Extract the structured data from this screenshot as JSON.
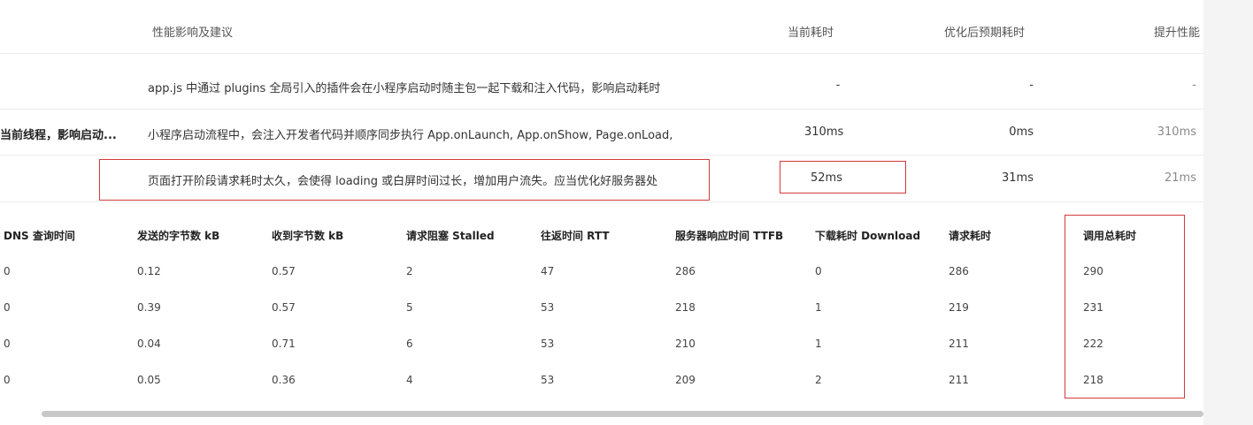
{
  "top_table": {
    "headers": {
      "impact": "性能影响及建议",
      "current": "当前耗时",
      "optimized": "优化后预期耗时",
      "improve": "提升性能"
    },
    "rows": [
      {
        "left": "",
        "desc": "app.js 中通过 plugins 全局引入的插件会在小程序启动时随主包一起下载和注入代码，影响启动耗时",
        "current": "-",
        "optimized": "-",
        "improve": "-"
      },
      {
        "left": "当前线程，影响启动...",
        "desc": "小程序启动流程中，会注入开发者代码并顺序同步执行 App.onLaunch, App.onShow, Page.onLoad,",
        "current": "310ms",
        "optimized": "0ms",
        "improve": "310ms"
      },
      {
        "left": "",
        "desc": "页面打开阶段请求耗时太久，会使得 loading 或白屏时间过长，增加用户流失。应当优化好服务器处",
        "current": "52ms",
        "optimized": "31ms",
        "improve": "21ms"
      }
    ]
  },
  "sub_table": {
    "headers": [
      "DNS 查询时间",
      "发送的字节数 kB",
      "收到字节数 kB",
      "请求阻塞 Stalled",
      "往返时间 RTT",
      "服务器响应时间 TTFB",
      "下载耗时 Download",
      "请求耗时",
      "调用总耗时"
    ],
    "rows": [
      [
        "0",
        "0.12",
        "0.57",
        "2",
        "47",
        "286",
        "0",
        "286",
        "290"
      ],
      [
        "0",
        "0.39",
        "0.57",
        "5",
        "53",
        "218",
        "1",
        "219",
        "231"
      ],
      [
        "0",
        "0.04",
        "0.71",
        "6",
        "53",
        "210",
        "1",
        "211",
        "222"
      ],
      [
        "0",
        "0.05",
        "0.36",
        "4",
        "53",
        "209",
        "2",
        "211",
        "218"
      ]
    ]
  },
  "highlight_color": "#d33a3a"
}
